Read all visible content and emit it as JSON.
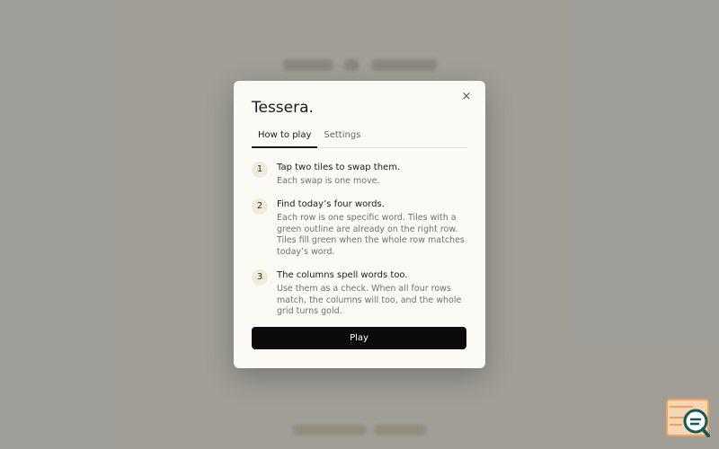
{
  "modal": {
    "title": "Tessera.",
    "close_symbol": "×",
    "tabs": [
      {
        "label": "How to play",
        "active": true
      },
      {
        "label": "Settings",
        "active": false
      }
    ],
    "steps": [
      {
        "number": "1",
        "heading": "Tap two tiles to swap them.",
        "body": "Each swap is one move."
      },
      {
        "number": "2",
        "heading": "Find today’s four words.",
        "body": "Each row is one specific word. Tiles with a green outline are already on the right row. Tiles fill green when the whole row matches today’s word."
      },
      {
        "number": "3",
        "heading": "The columns spell words too.",
        "body": "Use them as a check. When all four rows match, the columns will too, and the whole grid turns gold."
      }
    ],
    "play_label": "Play"
  },
  "corner_widget": {
    "icon": "search-icon"
  },
  "colors": {
    "overlay": "#797873",
    "modal_bg": "#fbfaf5",
    "button_bg": "#0b0b0b",
    "step_badge_bg": "#f0ecdb",
    "widget_accent": "#f0a15a",
    "widget_teal": "#0f5a5a"
  }
}
